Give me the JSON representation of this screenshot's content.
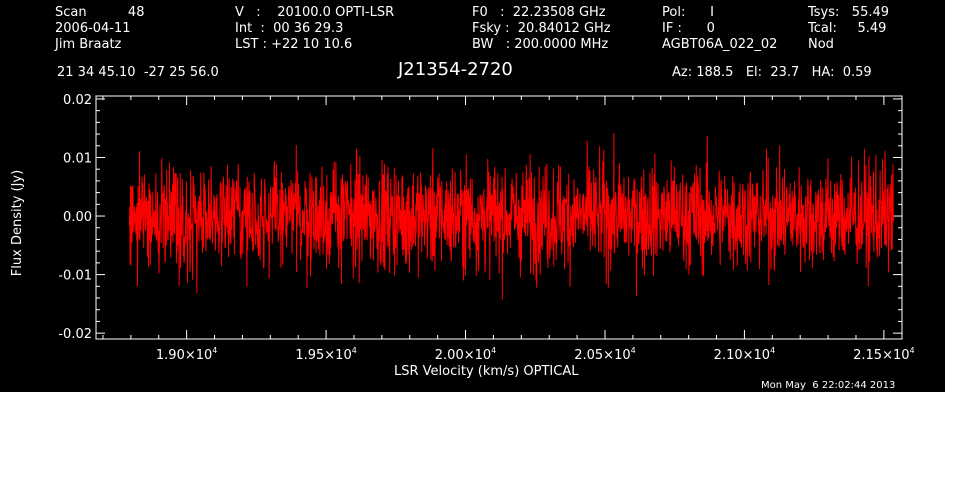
{
  "header": {
    "col1": [
      "Scan          48",
      "2006-04-11",
      "Jim Braatz"
    ],
    "col2": [
      "V   :    20100.0 OPTI-LSR",
      "Int  :  00 36 29.3",
      "LST : +22 10 10.6"
    ],
    "col3": [
      "F0   :  22.23508 GHz",
      "Fsky :  20.84012 GHz",
      "BW   : 200.0000 MHz"
    ],
    "col4": [
      "Pol:      I",
      "IF :      0",
      "AGBT06A_022_02"
    ],
    "col5": [
      "Tsys:   55.49",
      "Tcal:     5.49",
      "Nod"
    ],
    "coords": "21 34 45.10  -27 25 56.0",
    "source": "J21354-2720",
    "azelha": "Az: 188.5   El:  23.7   HA:  0.59",
    "timestamp": "Mon May  6 22:02:44 2013"
  },
  "colors": {
    "background": "#000000",
    "axes": "#ffffff",
    "series": "#ff0000"
  },
  "chart_data": {
    "type": "line",
    "xlabel": "LSR Velocity (km/s) OPTICAL",
    "ylabel": "Flux Density (Jy)",
    "xlim": [
      18675,
      21565
    ],
    "ylim": [
      -0.021,
      0.0205
    ],
    "x_ticks": [
      {
        "value": 19000,
        "mantissa": "1.90",
        "exp": "4"
      },
      {
        "value": 19500,
        "mantissa": "1.95",
        "exp": "4"
      },
      {
        "value": 20000,
        "mantissa": "2.00",
        "exp": "4"
      },
      {
        "value": 20500,
        "mantissa": "2.05",
        "exp": "4"
      },
      {
        "value": 21000,
        "mantissa": "2.10",
        "exp": "4"
      },
      {
        "value": 21500,
        "mantissa": "2.15",
        "exp": "4"
      }
    ],
    "y_ticks": [
      {
        "value": 0.02,
        "label": "0.02"
      },
      {
        "value": 0.01,
        "label": "0.01"
      },
      {
        "value": 0.0,
        "label": "0.00"
      },
      {
        "value": -0.01,
        "label": "-0.01"
      },
      {
        "value": -0.02,
        "label": "-0.02"
      }
    ],
    "series": [
      {
        "x_range": [
          18795,
          21535
        ],
        "mean": 0.0,
        "rms": 0.0045,
        "max": 0.0165,
        "min": -0.0172,
        "description_of_values": "noise spectrum centred on zero"
      }
    ]
  }
}
